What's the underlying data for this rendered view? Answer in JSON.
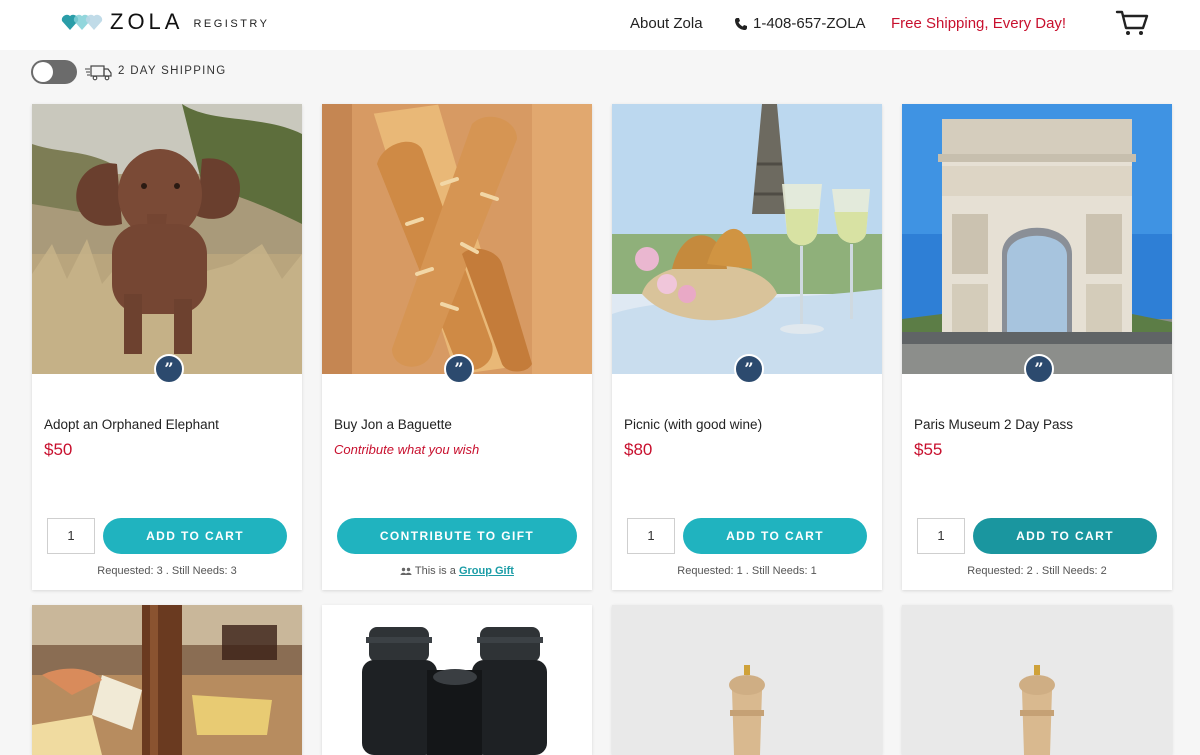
{
  "header": {
    "logo_word": "ZOLA",
    "logo_sub": "REGISTRY",
    "about": "About Zola",
    "phone": "1-408-657-ZOLA",
    "shipping_promo": "Free Shipping, Every Day!"
  },
  "shipping_filter": {
    "label": "2 DAY SHIPPING",
    "enabled": false
  },
  "colors": {
    "accent_teal": "#20b3bf",
    "price_red": "#c8102e",
    "badge_navy": "#2c4a6e"
  },
  "products": [
    {
      "title": "Adopt an Orphaned Elephant",
      "price": "$50",
      "qty": "1",
      "button": "ADD TO CART",
      "requested": "Requested: 3",
      "still_needs": "Still Needs: 3"
    },
    {
      "title": "Buy Jon a Baguette",
      "contribute_note": "Contribute what you wish",
      "button": "CONTRIBUTE TO GIFT",
      "group_prefix": "This is a",
      "group_link": "Group Gift"
    },
    {
      "title": "Picnic (with good wine)",
      "price": "$80",
      "qty": "1",
      "button": "ADD TO CART",
      "requested": "Requested: 1",
      "still_needs": "Still Needs: 1"
    },
    {
      "title": "Paris Museum 2 Day Pass",
      "price": "$55",
      "qty": "1",
      "button": "ADD TO CART",
      "requested": "Requested: 2",
      "still_needs": "Still Needs: 2"
    }
  ],
  "icons": {
    "logo": "heart-logo-icon",
    "phone": "phone-icon",
    "cart": "cart-icon",
    "truck": "truck-icon",
    "quote": "quote-icon",
    "group": "group-icon"
  }
}
